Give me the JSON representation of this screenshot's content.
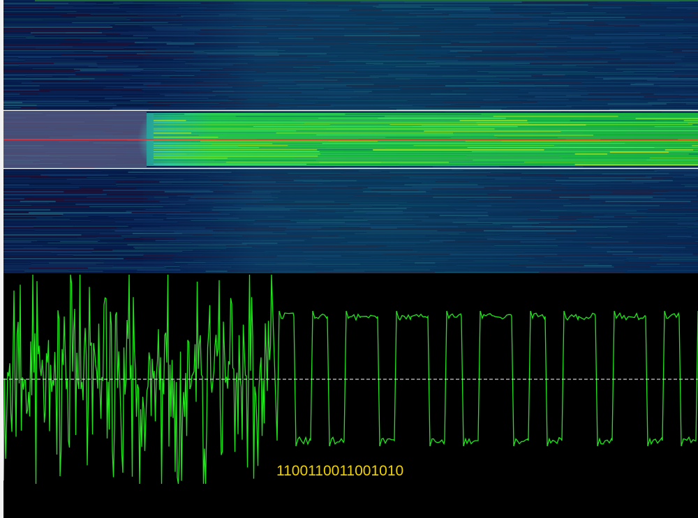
{
  "decoder": {
    "decoded_bits": "1100110011001010"
  },
  "colors": {
    "background": "#000000",
    "spectrogram_bg": "#06163e",
    "signal_band": "#23d62a",
    "selection_border": "#ffffff",
    "center_line": "#ff2a2a",
    "waveform": "#22e61c",
    "threshold_line": "#ffffff",
    "bits_text": "#f0d200"
  },
  "icons": {
    "threshold": "dashed-threshold-line",
    "center": "center-frequency-line"
  }
}
